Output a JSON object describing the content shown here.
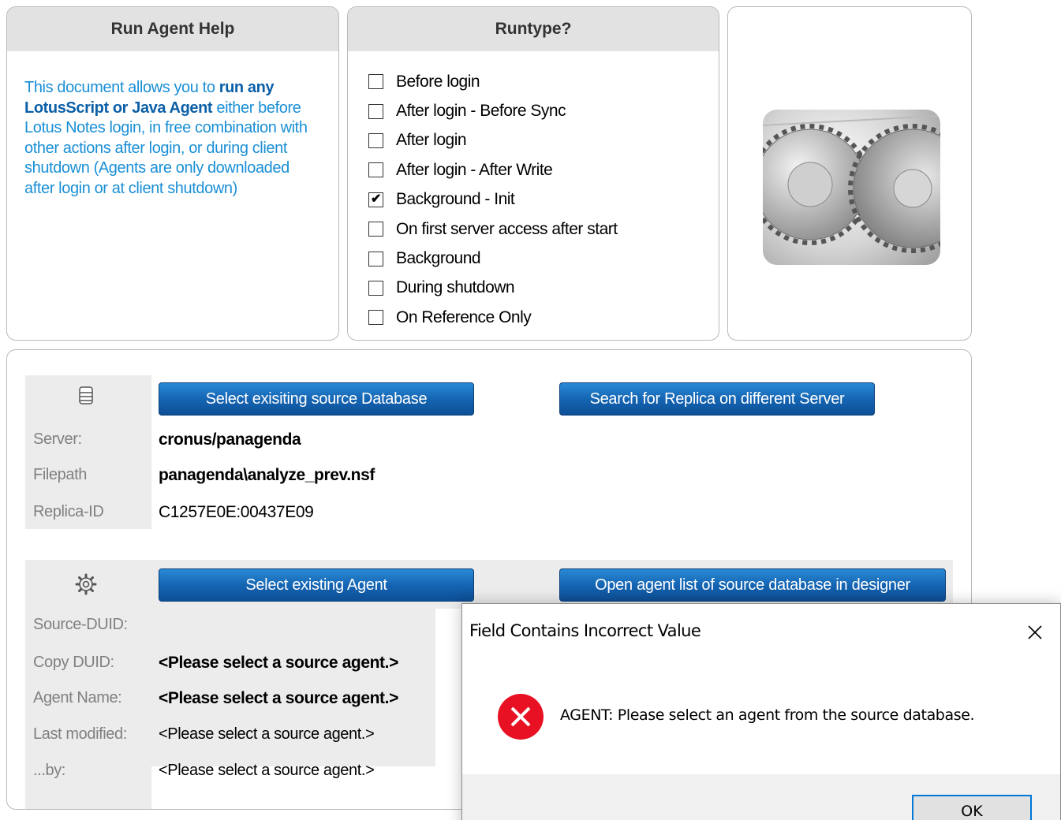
{
  "help": {
    "title": "Run Agent Help",
    "text_pre": "This document allows you to ",
    "text_bold": "run any LotusScript or Java Agent",
    "text_post": " either before Lotus Notes login, in free combination with other actions after login, or during client shutdown (Agents are only downloaded after login or at client shutdown)"
  },
  "runtype": {
    "title": "Runtype?",
    "options": [
      {
        "label": "Before login",
        "checked": false
      },
      {
        "label": "After login - Before Sync",
        "checked": false
      },
      {
        "label": "After login",
        "checked": false
      },
      {
        "label": "After login - After Write",
        "checked": false
      },
      {
        "label": "Background - Init",
        "checked": true
      },
      {
        "label": "On first server access after start",
        "checked": false
      },
      {
        "label": "Background",
        "checked": false
      },
      {
        "label": "During shutdown",
        "checked": false
      },
      {
        "label": "On Reference Only",
        "checked": false
      }
    ]
  },
  "database": {
    "icon": "database-icon",
    "select_button": "Select exisiting source Database",
    "search_button": "Search for Replica on different Server",
    "server_label": "Server:",
    "server_value": "cronus/panagenda",
    "filepath_label": "Filepath",
    "filepath_value": "panagenda\\analyze_prev.nsf",
    "replica_label": "Replica-ID",
    "replica_value": "C1257E0E:00437E09"
  },
  "agent": {
    "icon": "gear-icon",
    "select_button": "Select existing Agent",
    "open_button": "Open agent list of source database in designer",
    "source_duid_label": "Source-DUID:",
    "source_duid_value": "",
    "copy_duid_label": "Copy DUID:",
    "copy_duid_value": "<Please select a source agent.>",
    "agent_name_label": "Agent Name:",
    "agent_name_value": "<Please select a source agent.>",
    "last_modified_label": "Last modified:",
    "last_modified_value": "<Please select a source agent.>",
    "by_label": "...by:",
    "by_value": "<Please select a source agent.>"
  },
  "dialog": {
    "title": "Field Contains Incorrect Value",
    "message": "AGENT: Please select an agent from the source database.",
    "ok_label": "OK",
    "icon": "error-icon"
  },
  "colors": {
    "link_blue": "#1a8fd6",
    "button_blue": "#1565b3",
    "error_red": "#e81123"
  }
}
